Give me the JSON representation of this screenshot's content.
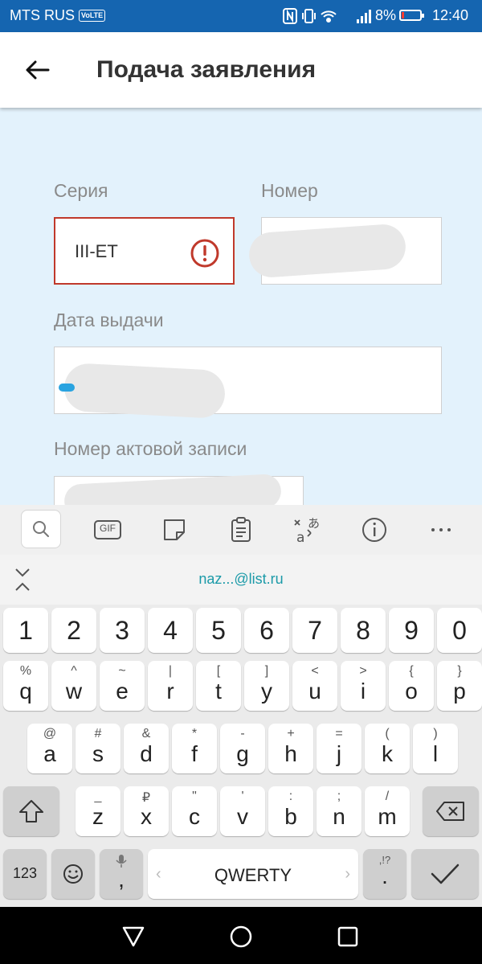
{
  "status_bar": {
    "carrier": "MTS RUS",
    "volte": "VoLTE",
    "battery": "8%",
    "time": "12:40"
  },
  "app_bar": {
    "title": "Подача заявления"
  },
  "form": {
    "series_label": "Серия",
    "series_value": "III-ЕТ",
    "number_label": "Номер",
    "issue_date_label": "Дата выдачи",
    "record_number_label": "Номер актовой записи"
  },
  "keyboard": {
    "suggestion": "naz...@list.ru",
    "gif_label": "GIF",
    "row_numbers": [
      "1",
      "2",
      "3",
      "4",
      "5",
      "6",
      "7",
      "8",
      "9",
      "0"
    ],
    "row1": [
      {
        "main": "q",
        "alt": "%"
      },
      {
        "main": "w",
        "alt": "^"
      },
      {
        "main": "e",
        "alt": "~"
      },
      {
        "main": "r",
        "alt": "|"
      },
      {
        "main": "t",
        "alt": "["
      },
      {
        "main": "y",
        "alt": "]"
      },
      {
        "main": "u",
        "alt": "<"
      },
      {
        "main": "i",
        "alt": ">"
      },
      {
        "main": "o",
        "alt": "{"
      },
      {
        "main": "p",
        "alt": "}"
      }
    ],
    "row2": [
      {
        "main": "a",
        "alt": "@"
      },
      {
        "main": "s",
        "alt": "#"
      },
      {
        "main": "d",
        "alt": "&"
      },
      {
        "main": "f",
        "alt": "*"
      },
      {
        "main": "g",
        "alt": "-"
      },
      {
        "main": "h",
        "alt": "+"
      },
      {
        "main": "j",
        "alt": "="
      },
      {
        "main": "k",
        "alt": "("
      },
      {
        "main": "l",
        "alt": ")"
      }
    ],
    "row3": [
      {
        "main": "z",
        "alt": "_"
      },
      {
        "main": "x",
        "alt": "₽"
      },
      {
        "main": "c",
        "alt": "\""
      },
      {
        "main": "v",
        "alt": "'"
      },
      {
        "main": "b",
        "alt": ":"
      },
      {
        "main": "n",
        "alt": ";"
      },
      {
        "main": "m",
        "alt": "/"
      }
    ],
    "sym_key": "123",
    "comma_key": ",",
    "space_label": "QWERTY",
    "period_key": ".",
    "period_alt": ",!?"
  }
}
